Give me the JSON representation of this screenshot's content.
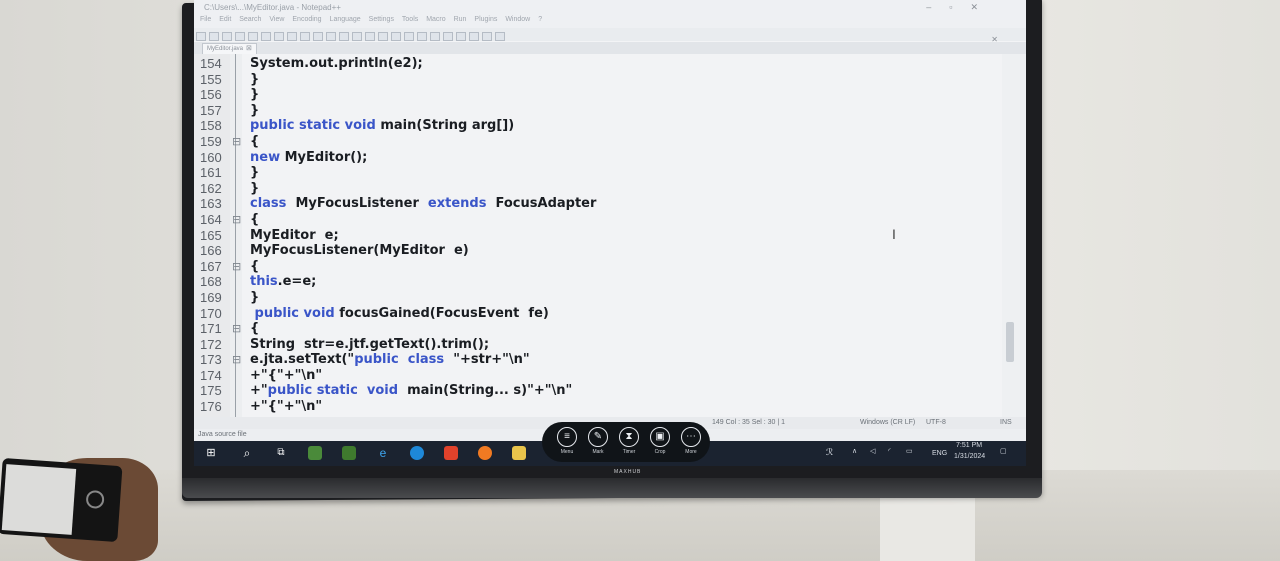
{
  "window": {
    "title": "C:\\Users\\...\\MyEditor.java - Notepad++",
    "controls": [
      "–",
      "▫",
      "✕"
    ]
  },
  "menu": [
    "File",
    "Edit",
    "Search",
    "View",
    "Encoding",
    "Language",
    "Settings",
    "Tools",
    "Macro",
    "Run",
    "Plugins",
    "Window",
    "?"
  ],
  "tab": {
    "label": "MyEditor.java"
  },
  "code_lines": [
    {
      "n": "154",
      "m": "",
      "t": "System.out.println(e2);"
    },
    {
      "n": "155",
      "m": "",
      "t": "}"
    },
    {
      "n": "156",
      "m": "",
      "t": "}"
    },
    {
      "n": "157",
      "m": "",
      "t": "}"
    },
    {
      "n": "158",
      "m": "",
      "t": "public static void main(String arg[])"
    },
    {
      "n": "159",
      "m": "⊟",
      "t": "{"
    },
    {
      "n": "160",
      "m": "",
      "t": "new MyEditor();"
    },
    {
      "n": "161",
      "m": "",
      "t": "}"
    },
    {
      "n": "162",
      "m": "",
      "t": "}"
    },
    {
      "n": "163",
      "m": "",
      "t": "class  MyFocusListener  extends  FocusAdapter"
    },
    {
      "n": "164",
      "m": "⊟",
      "t": "{"
    },
    {
      "n": "165",
      "m": "",
      "t": "MyEditor  e;"
    },
    {
      "n": "166",
      "m": "",
      "t": "MyFocusListener(MyEditor  e)"
    },
    {
      "n": "167",
      "m": "⊟",
      "t": "{"
    },
    {
      "n": "168",
      "m": "",
      "t": "this.e=e;"
    },
    {
      "n": "169",
      "m": "",
      "t": "}"
    },
    {
      "n": "170",
      "m": "",
      "t": " public void focusGained(FocusEvent  fe)"
    },
    {
      "n": "171",
      "m": "⊟",
      "t": "{"
    },
    {
      "n": "172",
      "m": "",
      "t": "String  str=e.jtf.getText().trim();"
    },
    {
      "n": "173",
      "m": "⊟",
      "t": "e.jta.setText(\"public  class  \"+str+\"\\n\""
    },
    {
      "n": "174",
      "m": "",
      "t": "+\"{\"+\"\\n\""
    },
    {
      "n": "175",
      "m": "",
      "t": "+\"public static  void  main(String... s)\"+\"\\n\""
    },
    {
      "n": "176",
      "m": "",
      "t": "+\"{\"+\"\\n\""
    }
  ],
  "status": {
    "position": "149   Col : 35   Sel : 30 | 1",
    "eol": "Windows (CR LF)",
    "encoding": "UTF-8",
    "mode": "INS",
    "file_type": "Java source file"
  },
  "float_toolbar": [
    "Menu",
    "Mark",
    "Timer",
    "Crop",
    "More"
  ],
  "tray": {
    "time": "7:51 PM",
    "date": "1/31/2024",
    "lang": "ENG"
  },
  "tv_brand": "MAXHUB"
}
